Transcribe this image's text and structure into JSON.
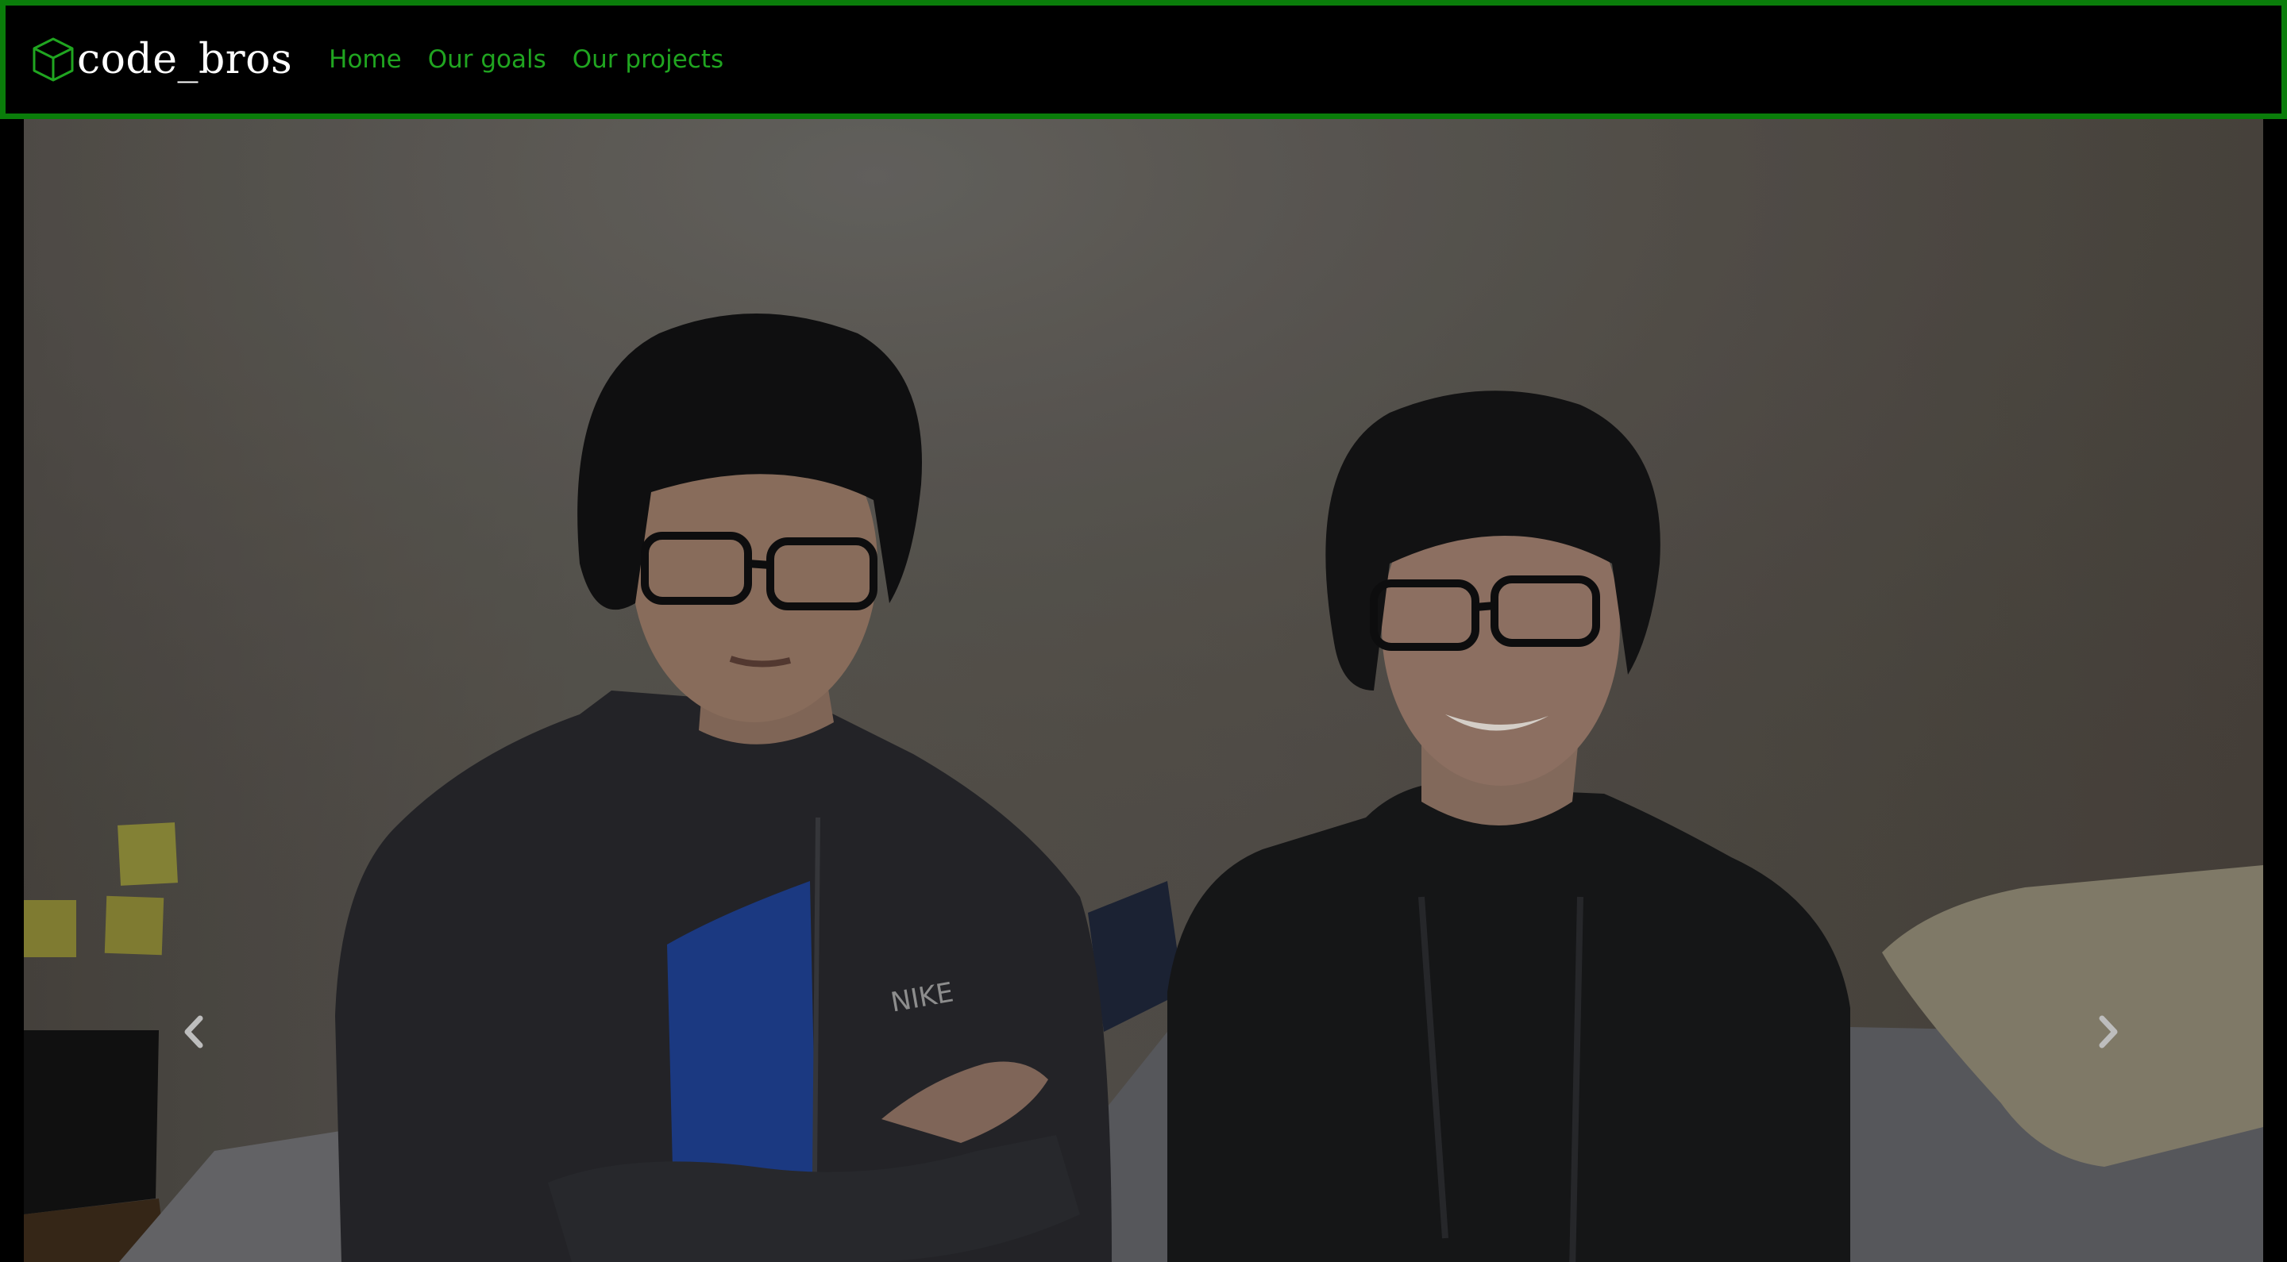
{
  "navbar": {
    "brand": "code_bros",
    "brand_icon": "cube-icon",
    "links": [
      {
        "label": "Home"
      },
      {
        "label": "Our goals"
      },
      {
        "label": "Our projects"
      }
    ]
  },
  "carousel": {
    "prev_icon": "chevron-left-icon",
    "next_icon": "chevron-right-icon"
  },
  "colors": {
    "accent": "#0a7d0a",
    "link": "#20a520",
    "background": "#000000"
  }
}
